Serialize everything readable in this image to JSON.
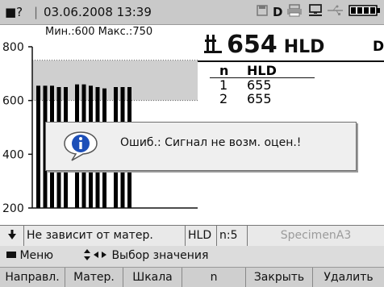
{
  "status": {
    "mode_glyph": "■?",
    "date_time": "03.06.2008  13:39",
    "icons": [
      "save-icon",
      "d-icon",
      "printer-icon",
      "pc-connection-icon",
      "usb-icon",
      "battery-icon"
    ],
    "d_label": "D"
  },
  "chart": {
    "minmax_label": "Мин.:600 Макс.:750",
    "tolerance_color": "#cfcfcf"
  },
  "chart_data": {
    "type": "bar",
    "yticks": [
      "800",
      "600",
      "400",
      "200"
    ],
    "ylim": [
      200,
      800
    ],
    "limits": {
      "min": 600,
      "max": 750
    },
    "values": [
      655,
      655,
      655,
      650,
      650,
      660,
      660,
      655,
      650,
      645,
      650,
      650,
      650
    ],
    "bar_color": "#000000"
  },
  "reading": {
    "value": "654",
    "unit": "HLD",
    "side_letter": "D"
  },
  "table": {
    "header_n": "n",
    "header_hld": "HLD",
    "rows": [
      {
        "n": "1",
        "v": "655"
      },
      {
        "n": "2",
        "v": "655"
      }
    ]
  },
  "dialog": {
    "message": "Ошиб.: Сигнал не возм. оцен.!",
    "icon": "info-icon"
  },
  "infobar": {
    "arrow": "🠗",
    "material": "Не зависит от матер.",
    "scale": "HLD",
    "count": "n:5",
    "specimen": "SpecimenA3"
  },
  "menubar": {
    "menu": "Меню",
    "select": "Выбор значения"
  },
  "softkeys": {
    "k1": "Направл.",
    "k2": "Матер.",
    "k3": "Шкала",
    "k4": "n",
    "k5": "Закрыть",
    "k6": "Удалить"
  }
}
